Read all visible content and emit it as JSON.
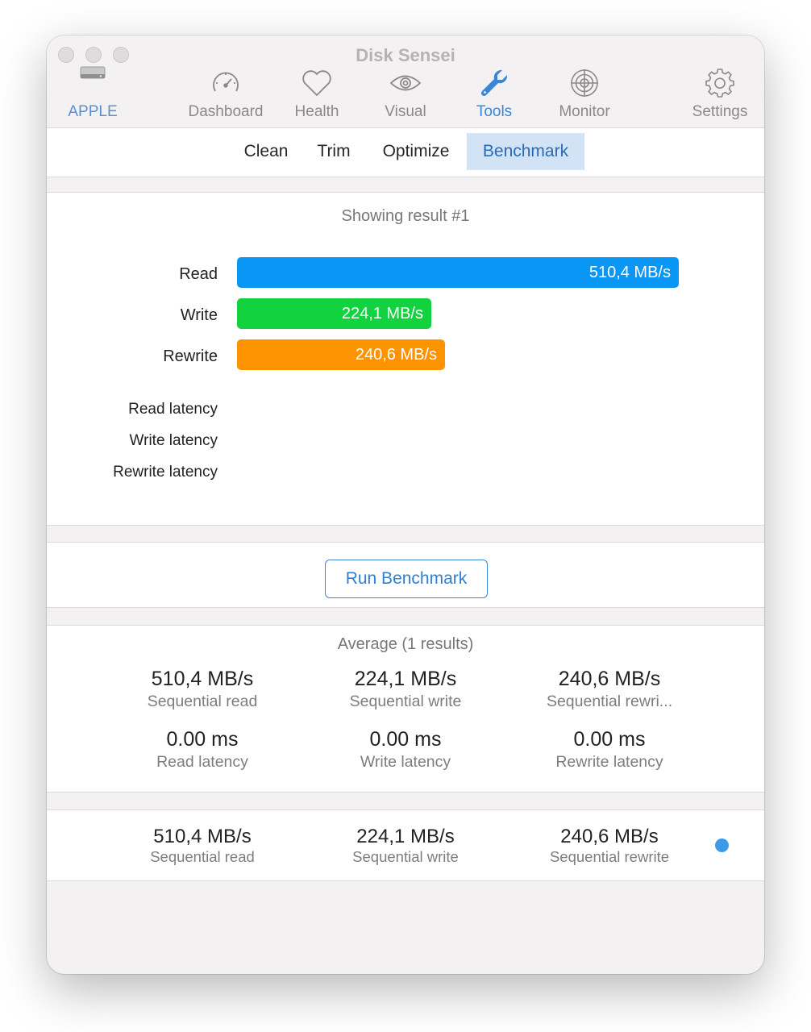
{
  "window": {
    "title": "Disk Sensei"
  },
  "toolbar": {
    "disk_label": "APPLE",
    "items": [
      {
        "label": "Dashboard",
        "icon": "speedometer-icon"
      },
      {
        "label": "Health",
        "icon": "heart-icon"
      },
      {
        "label": "Visual",
        "icon": "eye-icon"
      },
      {
        "label": "Tools",
        "icon": "wrench-icon",
        "active": true
      },
      {
        "label": "Monitor",
        "icon": "radar-icon"
      },
      {
        "label": "Settings",
        "icon": "gear-icon"
      }
    ]
  },
  "subtabs": [
    {
      "label": "Clean"
    },
    {
      "label": "Trim"
    },
    {
      "label": "Optimize"
    },
    {
      "label": "Benchmark",
      "active": true
    }
  ],
  "result": {
    "caption": "Showing result #1",
    "bars": [
      {
        "label": "Read",
        "value": "510,4 MB/s",
        "mbps": 510.4,
        "color": "#0a96f5"
      },
      {
        "label": "Write",
        "value": "224,1 MB/s",
        "mbps": 224.1,
        "color": "#12d33f"
      },
      {
        "label": "Rewrite",
        "value": "240,6 MB/s",
        "mbps": 240.6,
        "color": "#fe9302"
      }
    ],
    "latency_labels": [
      "Read latency",
      "Write latency",
      "Rewrite latency"
    ]
  },
  "run_button": {
    "label": "Run Benchmark"
  },
  "average": {
    "caption": "Average (1 results)",
    "stats": [
      {
        "value": "510,4 MB/s",
        "label": "Sequential read"
      },
      {
        "value": "224,1 MB/s",
        "label": "Sequential write"
      },
      {
        "value": "240,6 MB/s",
        "label": "Sequential rewri..."
      },
      {
        "value": "0.00 ms",
        "label": "Read latency"
      },
      {
        "value": "0.00 ms",
        "label": "Write latency"
      },
      {
        "value": "0.00 ms",
        "label": "Rewrite latency"
      }
    ]
  },
  "history": [
    {
      "read": {
        "value": "510,4 MB/s",
        "label": "Sequential read"
      },
      "write": {
        "value": "224,1 MB/s",
        "label": "Sequential write"
      },
      "rewrite": {
        "value": "240,6 MB/s",
        "label": "Sequential rewrite"
      },
      "indicator_color": "#3d9be6"
    }
  ],
  "colors": {
    "accent": "#3a86d8",
    "read_bar": "#0a96f5",
    "write_bar": "#12d33f",
    "rewrite_bar": "#fe9302",
    "active_tab_bg": "#d2e3f6"
  }
}
